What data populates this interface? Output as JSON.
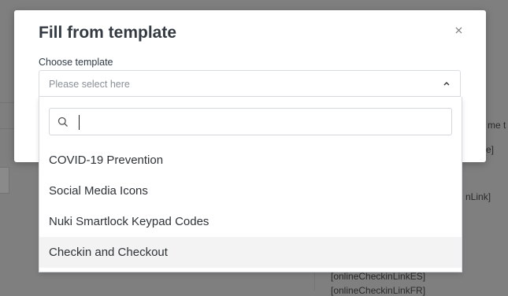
{
  "modal": {
    "title": "Fill from template",
    "close_icon": "close-icon",
    "choose_label": "Choose template",
    "select": {
      "placeholder": "Please select here",
      "icon": "chevron-up-icon",
      "expanded": true
    },
    "dropdown": {
      "search": {
        "value": "",
        "icon": "search-icon"
      },
      "options": [
        {
          "label": "COVID-19 Prevention",
          "highlighted": false
        },
        {
          "label": "Social Media Icons",
          "highlighted": false
        },
        {
          "label": "Nuki Smartlock Keypad Codes",
          "highlighted": false
        },
        {
          "label": "Checkin and Checkout",
          "highlighted": true
        }
      ]
    }
  },
  "background": {
    "fragments": [
      "me t",
      "e]",
      "nLink]",
      "[onlineCheckinLinkES]",
      "[onlineCheckinLinkFR]"
    ]
  },
  "colors": {
    "overlay": "#7f7f7f",
    "title": "#333a41",
    "hover_row": "#f3f3f3"
  }
}
